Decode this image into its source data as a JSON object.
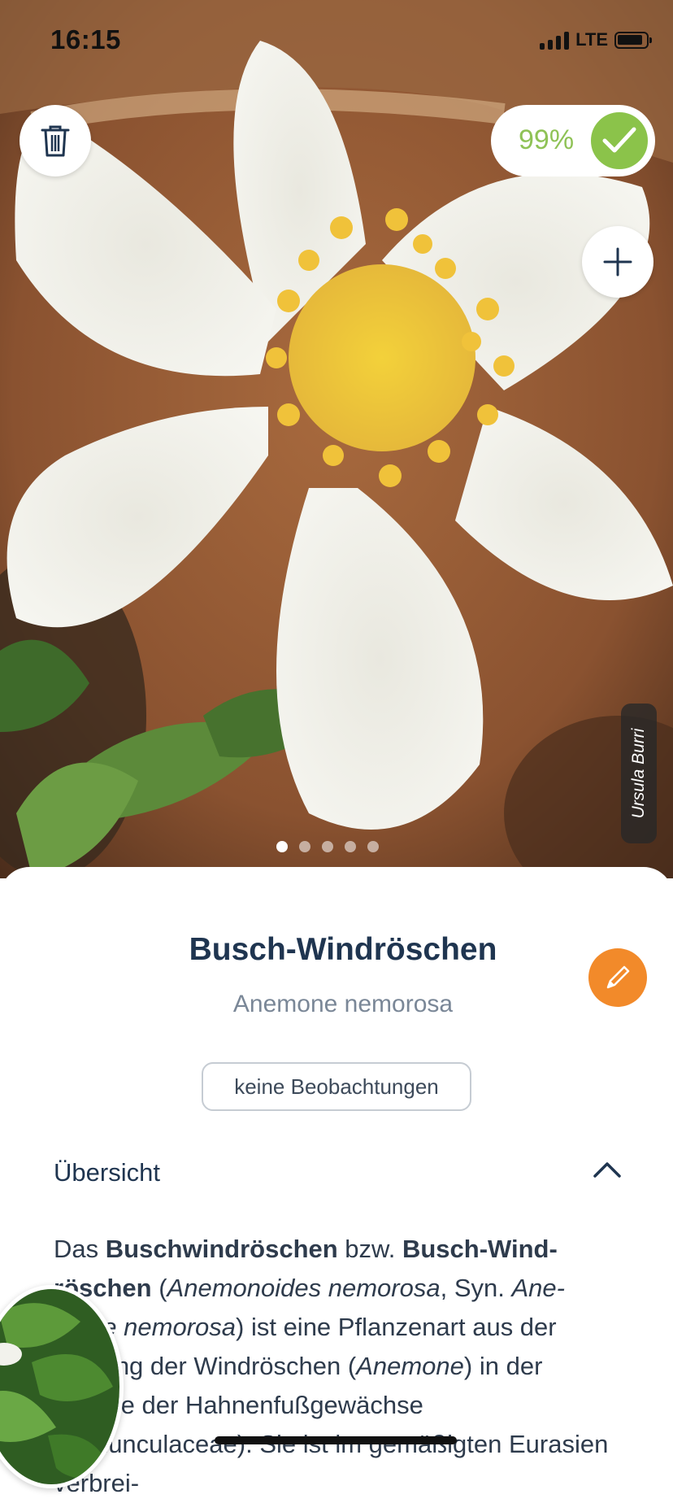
{
  "status_bar": {
    "time": "16:15",
    "network": "LTE"
  },
  "photo": {
    "confidence": "99%",
    "photographer": "Ursula Burri",
    "page_count": 5,
    "active_page": 0
  },
  "species": {
    "common_name": "Busch-Windröschen",
    "scientific_name": "Anemone nemorosa",
    "observations_label": "keine Beobachtungen"
  },
  "overview": {
    "title": "Übersicht",
    "parts": [
      {
        "t": "Das "
      },
      {
        "t": "Buschwindröschen",
        "b": true
      },
      {
        "t": " bzw. "
      },
      {
        "t": "Busch-Wind-röschen",
        "b": true
      },
      {
        "t": " ("
      },
      {
        "t": "Anemonoides nemorosa",
        "i": true
      },
      {
        "t": ", Syn. "
      },
      {
        "t": "Ane-mone nemorosa",
        "i": true
      },
      {
        "t": ") ist eine Pflanzenart aus der Gattung der Windröschen ("
      },
      {
        "t": "Anemone",
        "i": true
      },
      {
        "t": ") in der Familie der Hahnenfußgewächse (Ranunculaceae). Sie ist im gemäßigten Eurasien verbrei-"
      }
    ]
  },
  "colors": {
    "accent_orange": "#f28a2a",
    "confidence_green": "#8bc34a",
    "title_navy": "#1f3550"
  }
}
